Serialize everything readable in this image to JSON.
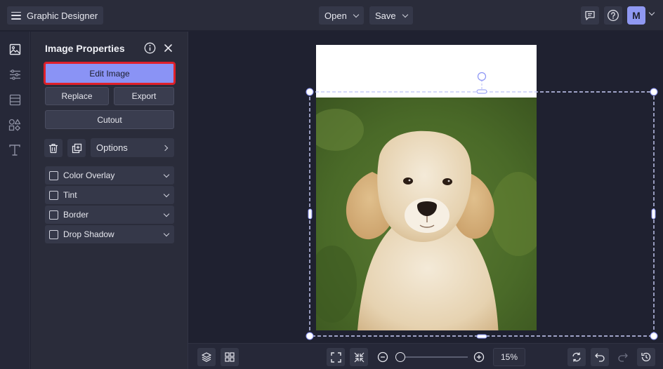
{
  "app": {
    "title": "Graphic Designer"
  },
  "toolbar": {
    "open_label": "Open",
    "save_label": "Save",
    "avatar_initial": "M"
  },
  "panel": {
    "title": "Image Properties",
    "edit_image_label": "Edit Image",
    "replace_label": "Replace",
    "export_label": "Export",
    "cutout_label": "Cutout",
    "options_label": "Options",
    "effects": [
      {
        "label": "Color Overlay",
        "checked": false
      },
      {
        "label": "Tint",
        "checked": false
      },
      {
        "label": "Border",
        "checked": false
      },
      {
        "label": "Drop Shadow",
        "checked": false
      }
    ]
  },
  "zoom": {
    "value": "15%",
    "level": 0.15
  },
  "colors": {
    "accent": "#8a93f5",
    "highlight": "#e0202a",
    "background": "#1f2130",
    "panel": "#2a2c3a"
  },
  "icons": {
    "rail": [
      "image-icon",
      "sliders-icon",
      "layout-icon",
      "shapes-icon",
      "text-icon"
    ],
    "bottom": [
      "layers-icon",
      "grid-icon",
      "fit-screen-icon",
      "shrink-icon",
      "zoom-out-icon",
      "zoom-in-icon",
      "rotate-icon",
      "undo-icon",
      "redo-icon",
      "history-icon"
    ]
  }
}
